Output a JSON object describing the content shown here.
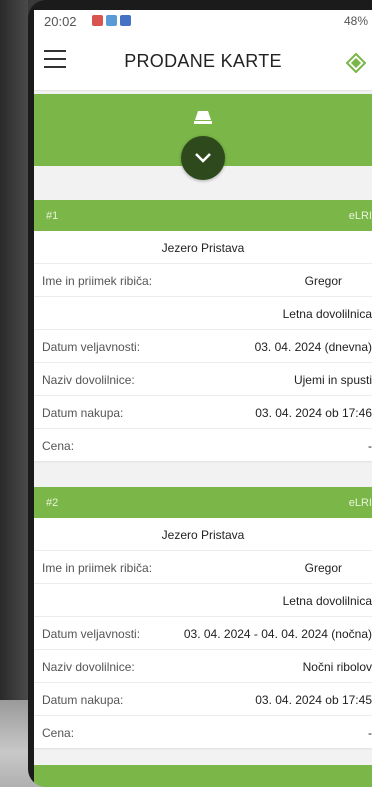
{
  "status_bar": {
    "time": "20:02",
    "battery": "48%"
  },
  "app_bar": {
    "title": "PRODANE KARTE"
  },
  "colors": {
    "accent": "#7ab648",
    "accent_dark": "#2e4a1d"
  },
  "icons": [
    "menu-icon",
    "app-logo-icon",
    "ticket-icon",
    "chevron-down-icon"
  ],
  "tickets": [
    {
      "number": "#1",
      "tag": "eLRI",
      "lake": "Jezero Pristava",
      "name_label": "Ime in priimek ribiča:",
      "name_value": "Gregor",
      "permit_type": "Letna dovolilnica",
      "validity_label": "Datum veljavnosti:",
      "validity_value": "03. 04. 2024 (dnevna)",
      "permit_name_label": "Naziv dovolilnice:",
      "permit_name_value": "Ujemi in spusti",
      "purchase_label": "Datum nakupa:",
      "purchase_value": "03. 04. 2024 ob 17:46",
      "price_label": "Cena:",
      "price_value": "-"
    },
    {
      "number": "#2",
      "tag": "eLRI",
      "lake": "Jezero Pristava",
      "name_label": "Ime in priimek ribiča:",
      "name_value": "Gregor",
      "permit_type": "Letna dovolilnica",
      "validity_label": "Datum veljavnosti:",
      "validity_value": "03. 04. 2024 - 04. 04. 2024 (nočna)",
      "permit_name_label": "Naziv dovolilnice:",
      "permit_name_value": "Nočni ribolov",
      "purchase_label": "Datum nakupa:",
      "purchase_value": "03. 04. 2024 ob 17:45",
      "price_label": "Cena:",
      "price_value": "-"
    }
  ]
}
